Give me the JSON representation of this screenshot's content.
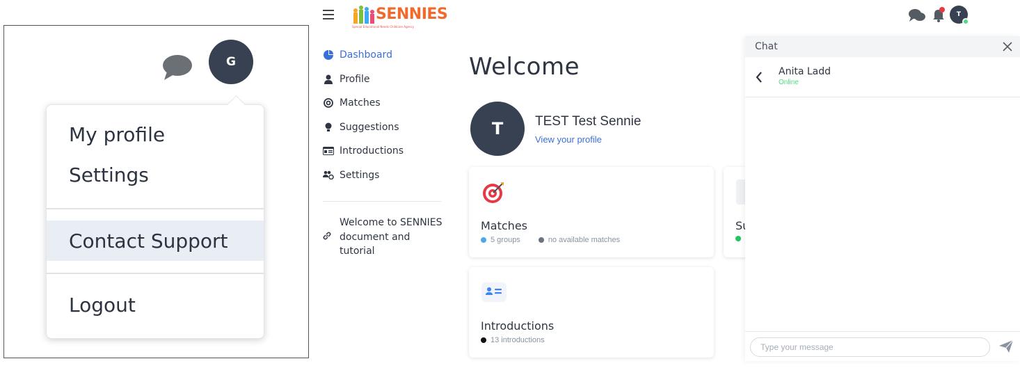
{
  "inset": {
    "avatar_letter": "G",
    "menu": {
      "my_profile": "My profile",
      "settings": "Settings",
      "contact_support": "Contact Support",
      "logout": "Logout"
    }
  },
  "header": {
    "logo_text": "SENNIES",
    "logo_tagline": "Special Educational Needs Childcare Agency",
    "avatar_letter": "T"
  },
  "sidebar": {
    "items": [
      {
        "label": "Dashboard",
        "icon": "pie-chart-icon",
        "active": true
      },
      {
        "label": "Profile",
        "icon": "user-icon"
      },
      {
        "label": "Matches",
        "icon": "target-icon"
      },
      {
        "label": "Suggestions",
        "icon": "lightbulb-icon"
      },
      {
        "label": "Introductions",
        "icon": "id-card-icon"
      },
      {
        "label": "Settings",
        "icon": "users-cog-icon"
      }
    ],
    "doc_link": {
      "line1": "Welcome to SENNIES",
      "line2": "document and",
      "line3": "tutorial",
      "icon": "link-icon"
    }
  },
  "main": {
    "title": "Welcome",
    "user": {
      "avatar_letter": "T",
      "name": "TEST Test Sennie",
      "view_profile": "View your profile"
    },
    "cards": {
      "matches": {
        "title": "Matches",
        "meta1": "5 groups",
        "meta2": "no available matches"
      },
      "suggestions": {
        "title": "Su"
      },
      "introductions": {
        "title": "Introductions",
        "meta1": "13 introductions"
      }
    }
  },
  "chat": {
    "title": "Chat",
    "contact_name": "Anita Ladd",
    "contact_status": "Online",
    "input_placeholder": "Type your message"
  },
  "colors": {
    "accent": "#3b6fd8",
    "avatar": "#374151",
    "online": "#4ade80",
    "logo": "#f06a2c"
  }
}
